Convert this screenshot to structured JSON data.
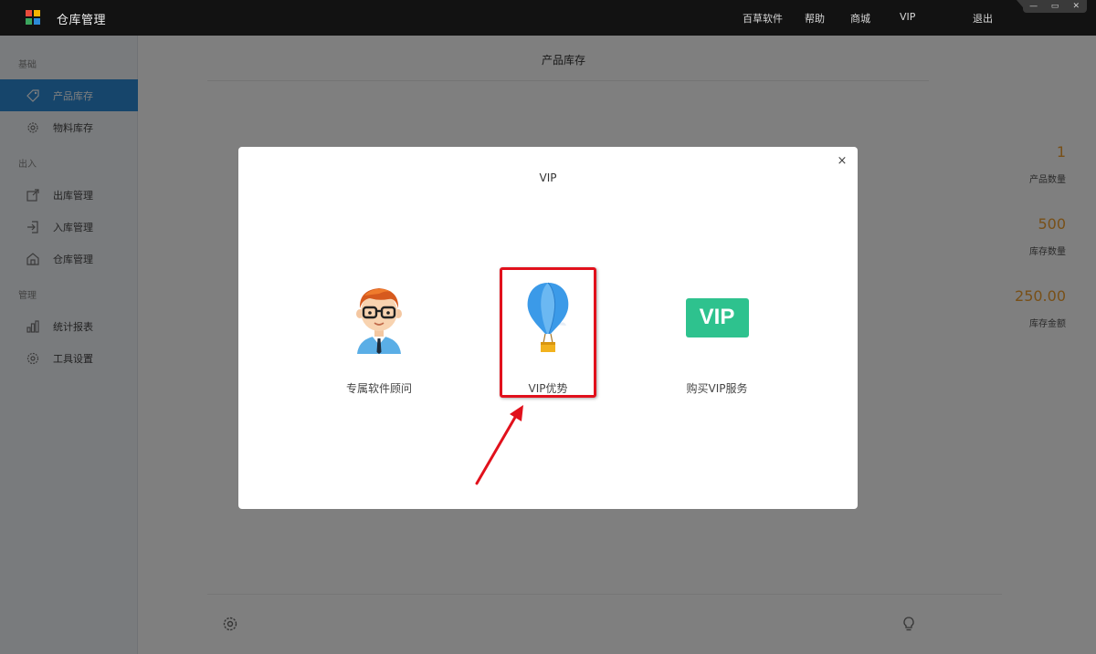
{
  "app": {
    "title": "仓库管理",
    "nav": [
      "百草软件",
      "帮助",
      "商城",
      "VIP",
      "退出"
    ],
    "window_controls": [
      "—",
      "▭",
      "✕"
    ]
  },
  "sidebar": {
    "groups": [
      {
        "label": "基础",
        "items": [
          {
            "label": "产品库存",
            "icon": "tag-icon",
            "active": true
          },
          {
            "label": "物料库存",
            "icon": "gear-icon",
            "active": false
          }
        ]
      },
      {
        "label": "出入",
        "items": [
          {
            "label": "出库管理",
            "icon": "export-icon",
            "active": false
          },
          {
            "label": "入库管理",
            "icon": "import-icon",
            "active": false
          },
          {
            "label": "仓库管理",
            "icon": "warehouse-icon",
            "active": false
          }
        ]
      },
      {
        "label": "管理",
        "items": [
          {
            "label": "统计报表",
            "icon": "chart-icon",
            "active": false
          },
          {
            "label": "工具设置",
            "icon": "settings-icon",
            "active": false
          }
        ]
      }
    ]
  },
  "main": {
    "title": "产品库存",
    "stats": [
      {
        "value": "1",
        "label": "产品数量"
      },
      {
        "value": "500",
        "label": "库存数量"
      },
      {
        "value": "250.00",
        "label": "库存金额"
      }
    ]
  },
  "modal": {
    "title": "VIP",
    "close_label": "×",
    "options": [
      {
        "label": "专属软件顾问",
        "icon": "consultant-avatar-icon"
      },
      {
        "label": "VIP优势",
        "icon": "hot-air-balloon-icon",
        "highlighted": true
      },
      {
        "label": "购买VIP服务",
        "icon": "vip-badge-icon",
        "badge_text": "VIP"
      }
    ]
  },
  "colors": {
    "titlebar": "#121212",
    "sidebar_active": "#2c8ad6",
    "stat_value": "#f0a030",
    "vip_badge": "#2ec28e",
    "balloon": "#3b9ae8",
    "highlight": "#e1111c"
  }
}
